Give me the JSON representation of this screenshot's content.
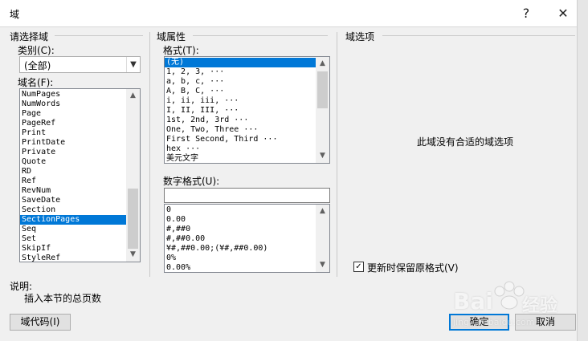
{
  "window": {
    "title": "域",
    "help_glyph": "?",
    "close_glyph": "✕"
  },
  "left": {
    "group_title": "请选择域",
    "category_label": "类别(C):",
    "category_value": "(全部)",
    "field_names_label": "域名(F):",
    "field_names": [
      "NumPages",
      "NumWords",
      "Page",
      "PageRef",
      "Print",
      "PrintDate",
      "Private",
      "Quote",
      "RD",
      "Ref",
      "RevNum",
      "SaveDate",
      "Section",
      "SectionPages",
      "Seq",
      "Set",
      "SkipIf",
      "StyleRef"
    ],
    "selected_field": "SectionPages"
  },
  "middle": {
    "group_title": "域属性",
    "format_label": "格式(T):",
    "formats": [
      "(无)",
      "1, 2, 3, ···",
      "a, b, c, ···",
      "A, B, C, ···",
      "i, ii, iii, ···",
      "I, II, III, ···",
      "1st, 2nd, 3rd ···",
      "One, Two, Three ···",
      "First Second, Third ···",
      "hex ···",
      "美元文字"
    ],
    "selected_format": "(无)",
    "number_format_label": "数字格式(U):",
    "number_format_value": "",
    "number_formats": [
      "0",
      "0.00",
      "#,##0",
      "#,##0.00",
      "¥#,##0.00;(¥#,##0.00)",
      "0%",
      "0.00%"
    ]
  },
  "right": {
    "group_title": "域选项",
    "no_options_text": "此域没有合适的域选项",
    "preserve_format_label": "更新时保留原格式(V)",
    "preserve_format_checked": true
  },
  "description": {
    "label": "说明:",
    "text": "插入本节的总页数"
  },
  "buttons": {
    "field_codes": "域代码(I)",
    "ok": "确定",
    "cancel": "取消"
  },
  "watermark": {
    "brand": "Bai",
    "brand_tail": "经验",
    "url": "jingyan.baidu.com"
  }
}
